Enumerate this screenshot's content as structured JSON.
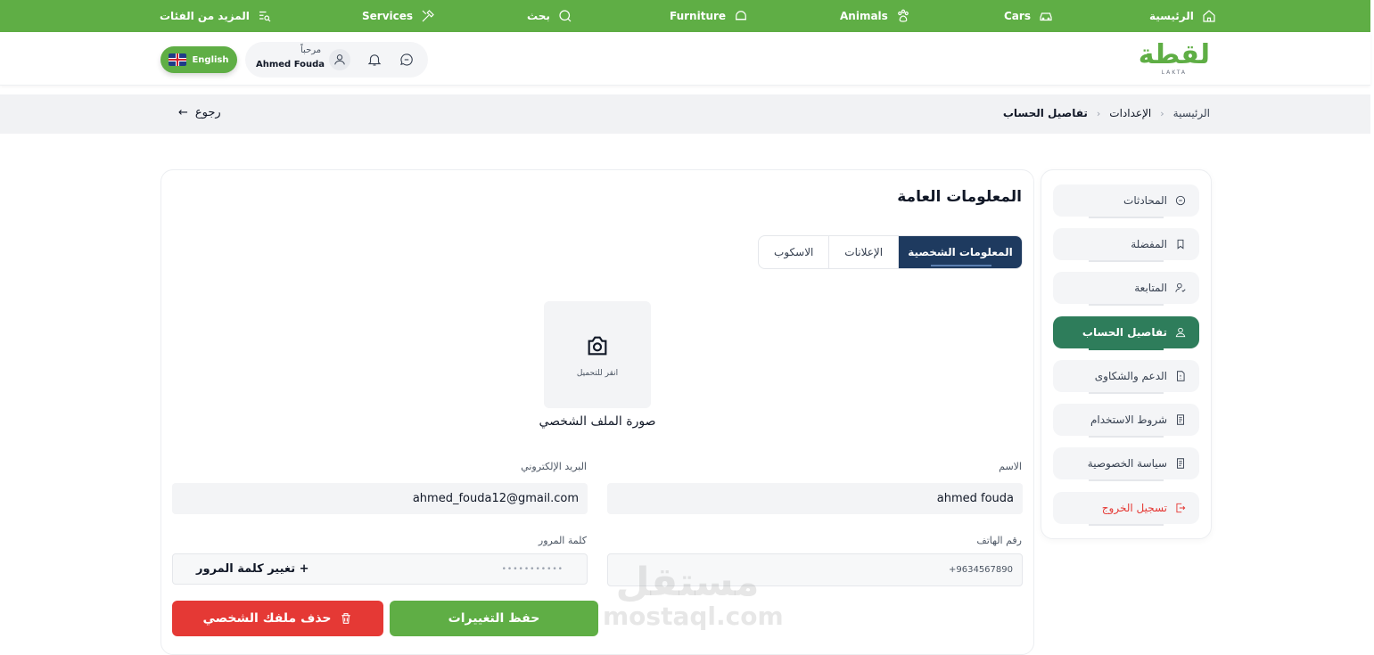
{
  "topnav": {
    "home": "الرئيسية",
    "cars": "Cars",
    "animals": "Animals",
    "furniture": "Furniture",
    "search": "بحث",
    "services": "Services",
    "more": "المزيد من الفئات"
  },
  "header": {
    "logo": "لقطة",
    "logo_sub": "LAKTA",
    "greeting": "مرحباً",
    "user_name": "Ahmed Fouda",
    "lang": "English"
  },
  "breadcrumb": {
    "home": "الرئيسية",
    "settings": "الإعدادات",
    "current": "تفاصيل الحساب",
    "back": "رجوع"
  },
  "sidebar": {
    "items": [
      {
        "label": "المحادثات",
        "icon": "chat-icon"
      },
      {
        "label": "المفضلة",
        "icon": "bookmark-icon"
      },
      {
        "label": "المتابعة",
        "icon": "user-check-icon"
      },
      {
        "label": "تفاصيل الحساب",
        "icon": "user-icon"
      },
      {
        "label": "الدعم والشكاوى",
        "icon": "support-icon"
      },
      {
        "label": "شروط الاستخدام",
        "icon": "document-icon"
      },
      {
        "label": "سياسة الخصوصية",
        "icon": "document-icon"
      },
      {
        "label": "تسجيل الخروج",
        "icon": "logout-icon"
      }
    ]
  },
  "main": {
    "title": "المعلومات العامة",
    "tabs": [
      "المعلومات الشخصية",
      "الإعلانات",
      "الاسكوب"
    ],
    "upload_hint": "انقر للتحميل",
    "upload_label": "صورة الملف الشخصي",
    "fields": {
      "name_label": "الاسم",
      "name_value": "ahmed fouda",
      "email_label": "البريد الإلكتروني",
      "email_value": "ahmed_fouda12@gmail.com",
      "phone_label": "رقم الهاتف",
      "phone_value": "+9634567890",
      "password_label": "كلمة المرور",
      "password_mask": "•••••••••••",
      "change_password": "تغيير كلمة المرور  +"
    },
    "save_button": "حفظ التغييرات",
    "delete_button": "حذف ملفك الشخصي"
  },
  "watermark": {
    "ar": "مستقل",
    "en": "mostaql.com"
  },
  "colors": {
    "brand_green": "#5fae45",
    "active_sidebar": "#2e7d5b",
    "active_tab": "#1e3a5f",
    "danger": "#e53935"
  }
}
